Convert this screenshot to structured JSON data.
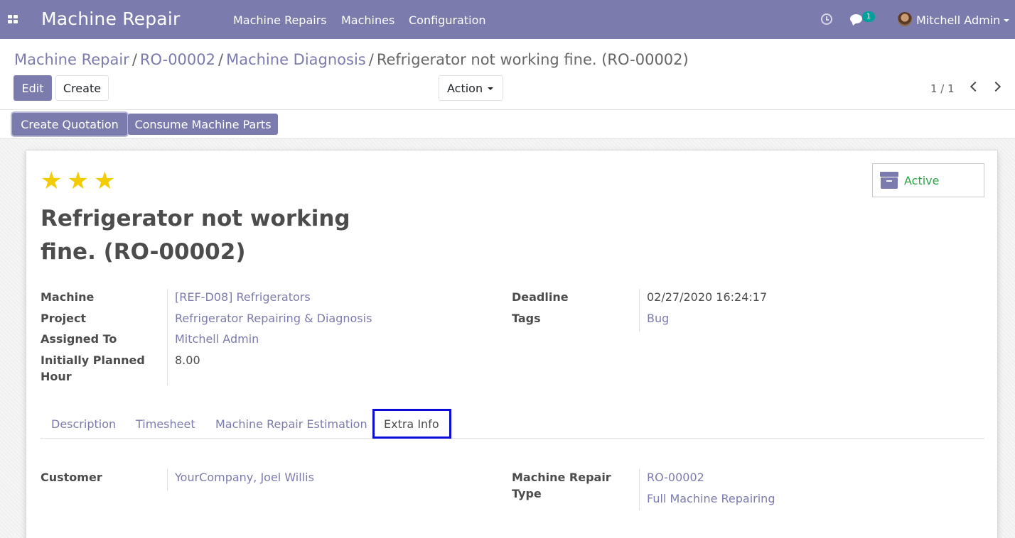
{
  "navbar": {
    "app_title": "Machine Repair",
    "menu": [
      "Machine Repairs",
      "Machines",
      "Configuration"
    ],
    "chat_badge": "1",
    "user_name": "Mitchell Admin",
    "accent_color": "#7c7bad"
  },
  "breadcrumb": {
    "items": [
      "Machine Repair",
      "RO-00002",
      "Machine Diagnosis"
    ],
    "separator": "/",
    "current": "Refrigerator not working fine. (RO-00002)"
  },
  "controls": {
    "edit_label": "Edit",
    "create_label": "Create",
    "action_label": "Action",
    "pager": "1 / 1"
  },
  "header_buttons": {
    "create_quotation": "Create Quotation",
    "consume_parts": "Consume Machine Parts"
  },
  "record": {
    "priority_stars": 3,
    "status_label": "Active",
    "title": "Refrigerator not working fine. (RO-00002)",
    "left_fields": [
      {
        "label": "Machine",
        "value": "[REF-D08] Refrigerators"
      },
      {
        "label": "Project",
        "value": "Refrigerator Repairing & Diagnosis"
      },
      {
        "label": "Assigned To",
        "value": "Mitchell Admin"
      },
      {
        "label": "Initially Planned Hour",
        "value": "8.00"
      }
    ],
    "right_fields": [
      {
        "label": "Deadline",
        "value": "02/27/2020 16:24:17"
      },
      {
        "label": "Tags",
        "value": "Bug"
      }
    ]
  },
  "tabs": [
    {
      "label": "Description"
    },
    {
      "label": "Timesheet"
    },
    {
      "label": "Machine Repair Estimation"
    },
    {
      "label": "Extra Info",
      "selected": true
    }
  ],
  "extra_info": {
    "left_fields": [
      {
        "label": "Customer",
        "value": "YourCompany, Joel Willis"
      }
    ],
    "right_fields": [
      {
        "label": "Machine Repair Type",
        "value": "RO-00002"
      },
      {
        "label": "",
        "value": "Full Machine Repairing"
      }
    ]
  }
}
